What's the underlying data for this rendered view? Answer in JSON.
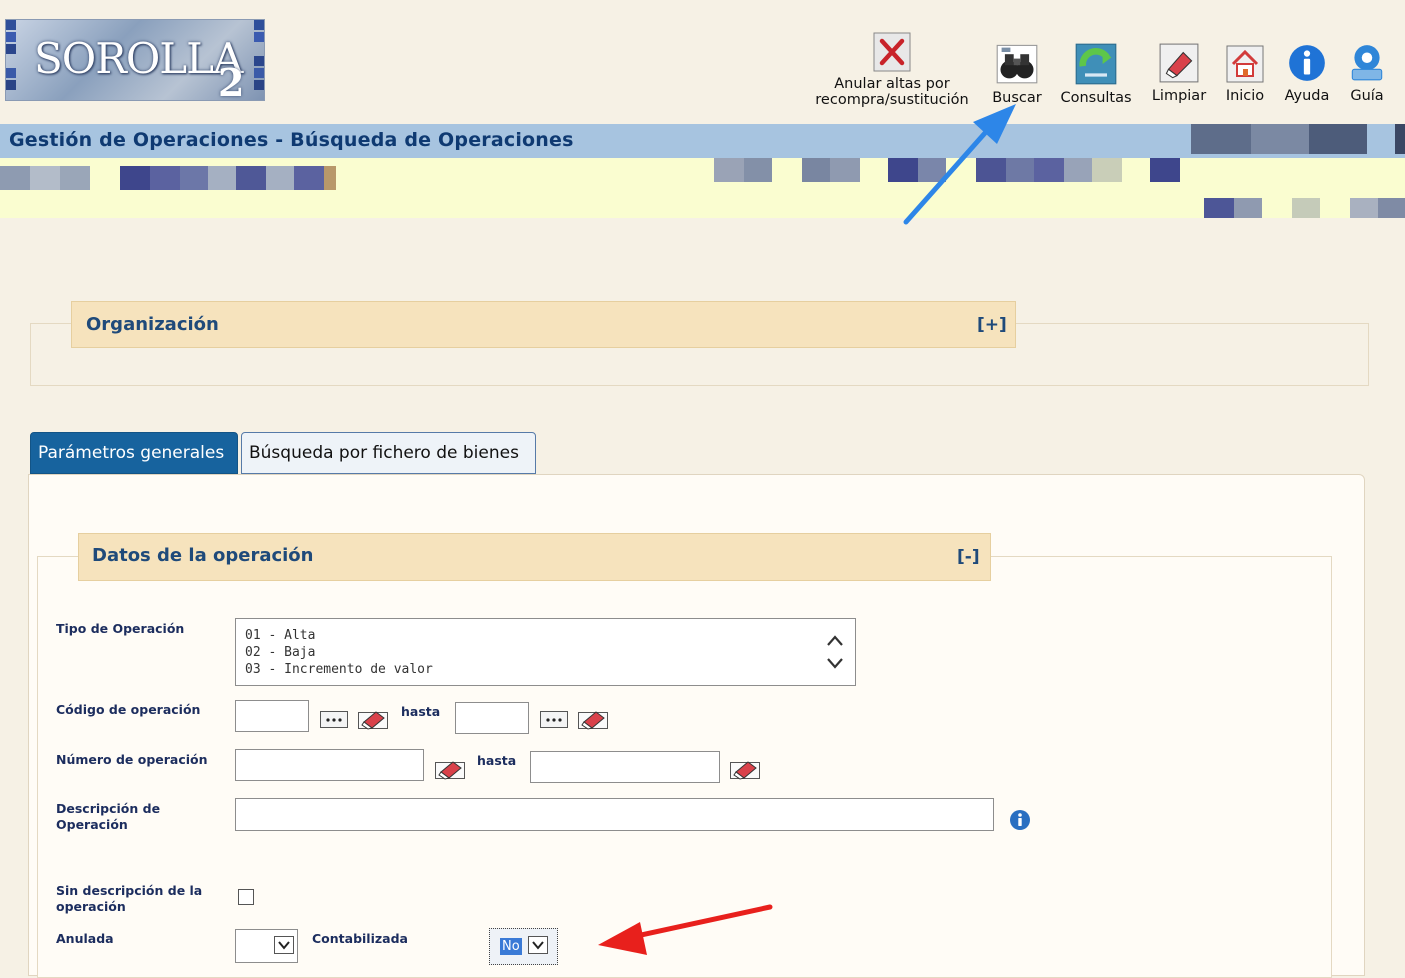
{
  "logo": {
    "word": "SOROLLA",
    "number": "2"
  },
  "toolbar": {
    "anular": "Anular altas por\nrecompra/sustitución",
    "buscar": "Buscar",
    "consultas": "Consultas",
    "limpiar": "Limpiar",
    "inicio": "Inicio",
    "ayuda": "Ayuda",
    "guia": "Guía"
  },
  "header": {
    "title": "Gestión de Operaciones - Búsqueda de Operaciones"
  },
  "organizacion": {
    "title": "Organización",
    "toggle": "[+]"
  },
  "tabs": [
    {
      "label": "Parámetros generales",
      "active": true
    },
    {
      "label": "Búsqueda por fichero de bienes",
      "active": false
    }
  ],
  "datos": {
    "title": "Datos de la operación",
    "toggle": "[-]",
    "tipo_label": "Tipo de Operación",
    "tipo_options": [
      "01 - Alta",
      "02 - Baja",
      "03 - Incremento de valor"
    ],
    "codigo_label": "Código de operación",
    "hasta": "hasta",
    "numero_label": "Número de operación",
    "descripcion_label": "Descripción de Operación",
    "sin_descripcion_label": "Sin descripción de la operación",
    "anulada_label": "Anulada",
    "anulada_value": "",
    "contabilizada_label": "Contabilizada",
    "contabilizada_value": "No"
  },
  "colors": {
    "titlebar": "#a7c4e0",
    "title_text": "#0f3a72",
    "tab_active": "#17639e",
    "legend_bg": "#f6e3bd",
    "annotation_blue": "#2d86e8",
    "annotation_red": "#e8201c"
  }
}
